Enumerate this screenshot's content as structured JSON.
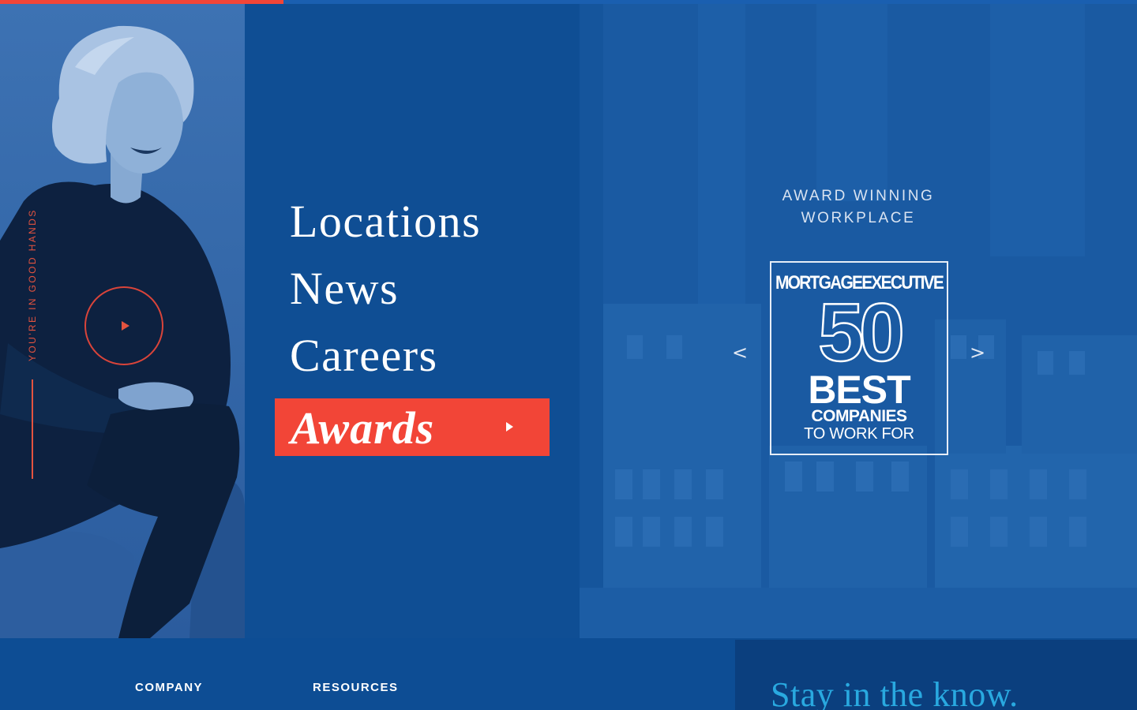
{
  "colors": {
    "accent": "#f24537",
    "navy": "#0f4e94",
    "newsletter_title": "#29a9e0"
  },
  "photo_panel": {
    "vertical_text": "YOU'RE IN GOOD HANDS",
    "play_icon": "play-icon"
  },
  "nav": {
    "items": [
      {
        "label": "Locations"
      },
      {
        "label": "News"
      },
      {
        "label": "Careers"
      }
    ],
    "active": {
      "label": "Awards",
      "icon": "play-arrow-icon"
    }
  },
  "award": {
    "heading_line1": "AWARD WINNING",
    "heading_line2": "WORKPLACE",
    "prev_label": "<",
    "next_label": ">",
    "badge": {
      "publication": "MORTGAGEEXECUTIVE",
      "number": "50",
      "best": "BEST",
      "line1": "COMPANIES",
      "line2": "TO WORK FOR"
    }
  },
  "footer": {
    "company_label": "COMPANY",
    "resources_label": "RESOURCES",
    "newsletter_title": "Stay in the know."
  }
}
